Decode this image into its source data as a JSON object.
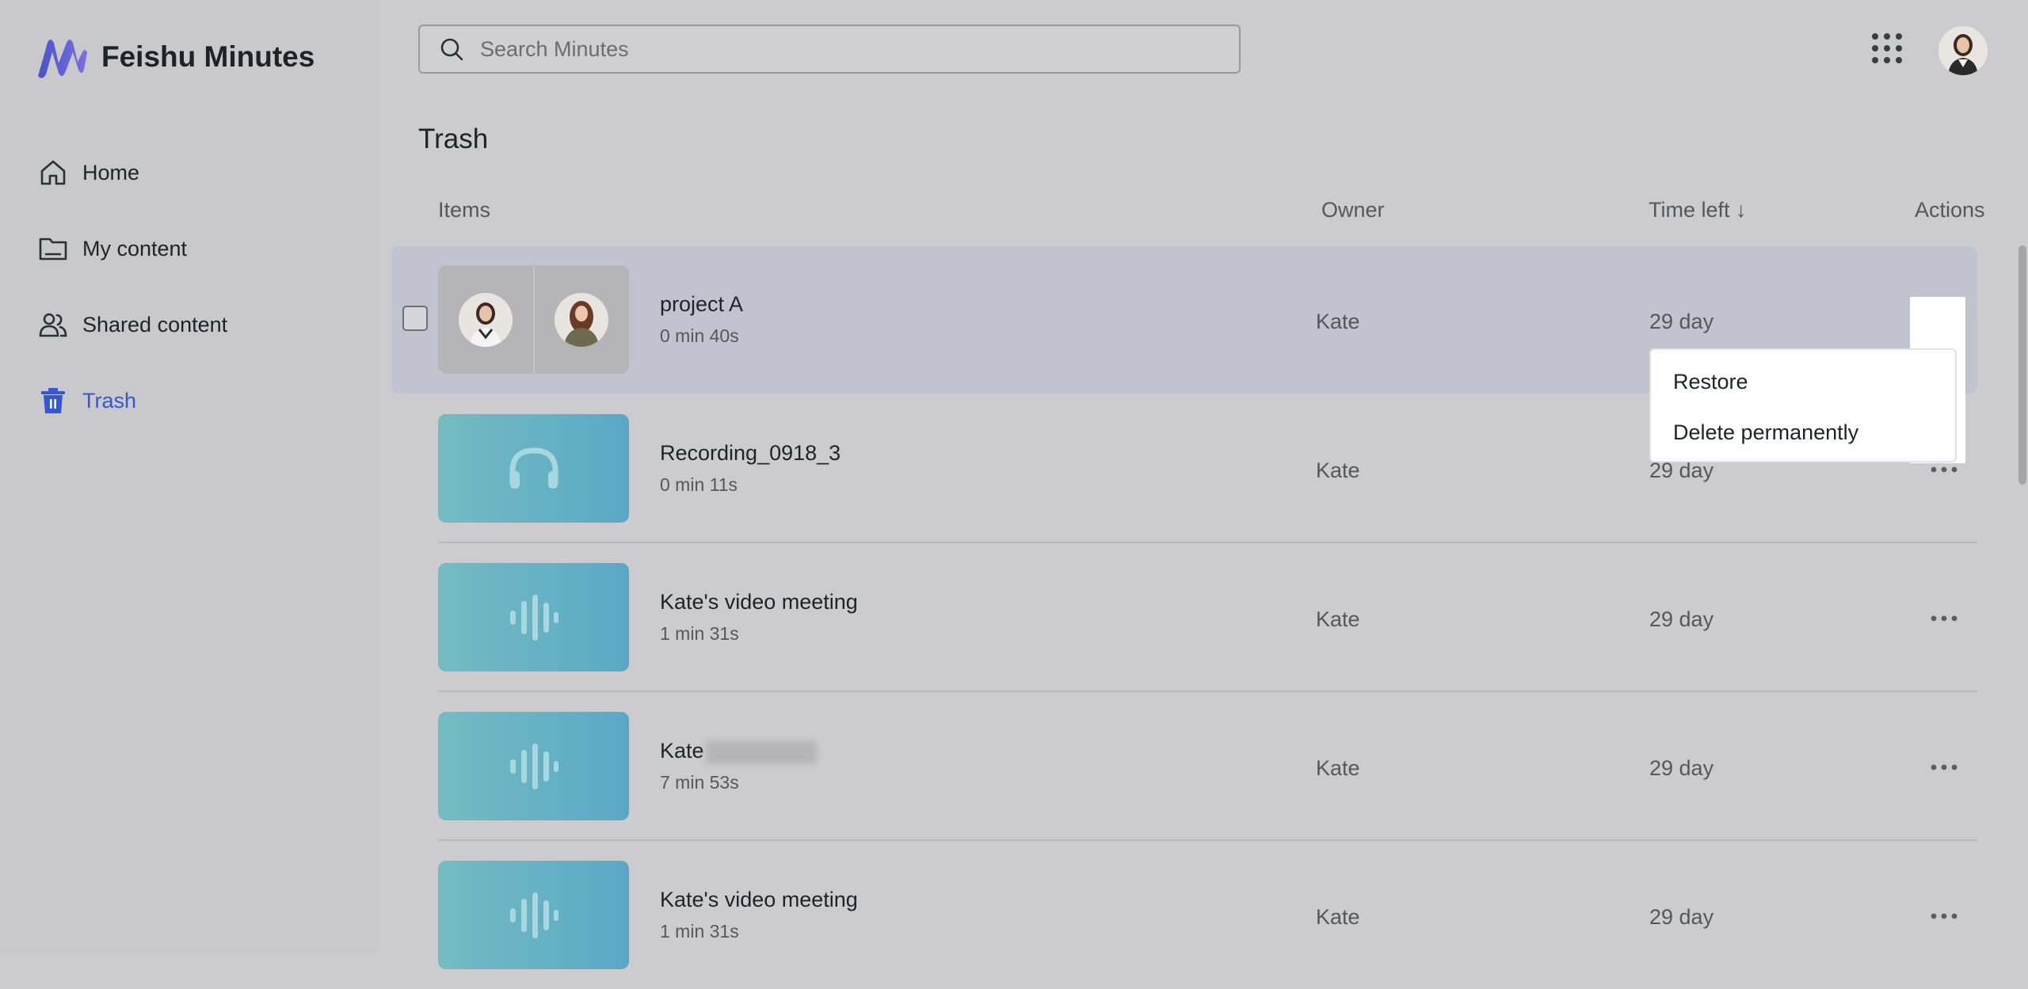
{
  "brand": {
    "name": "Feishu Minutes",
    "logo_icon": "feishu-minutes-logo"
  },
  "sidebar": {
    "items": [
      {
        "label": "Home",
        "icon": "home-icon"
      },
      {
        "label": "My content",
        "icon": "folder-icon"
      },
      {
        "label": "Shared content",
        "icon": "users-icon"
      },
      {
        "label": "Trash",
        "icon": "trash-icon",
        "active": true
      }
    ]
  },
  "search": {
    "placeholder": "Search Minutes"
  },
  "page": {
    "title": "Trash"
  },
  "table": {
    "headers": {
      "items": "Items",
      "owner": "Owner",
      "time_left": "Time left ↓",
      "actions": "Actions"
    },
    "rows": [
      {
        "title": "project A",
        "duration": "0 min 40s",
        "owner": "Kate",
        "time_left": "29 day",
        "thumb": "people"
      },
      {
        "title": "Recording_0918_3",
        "duration": "0 min 11s",
        "owner": "Kate",
        "time_left": "29 day",
        "thumb": "headphones"
      },
      {
        "title": "Kate's video meeting",
        "duration": "1 min 31s",
        "owner": "Kate",
        "time_left": "29 day",
        "thumb": "waveform"
      },
      {
        "title": "Kate",
        "duration": "7 min 53s",
        "owner": "Kate",
        "time_left": "29 day",
        "thumb": "waveform"
      },
      {
        "title": "Kate's video meeting",
        "duration": "1 min 31s",
        "owner": "Kate",
        "time_left": "29 day",
        "thumb": "waveform"
      }
    ]
  },
  "context_menu": {
    "restore": "Restore",
    "delete": "Delete permanently"
  },
  "colors": {
    "accent": "#3357d6",
    "thumb_start": "#73bcc2",
    "thumb_end": "#5aa8c7"
  }
}
